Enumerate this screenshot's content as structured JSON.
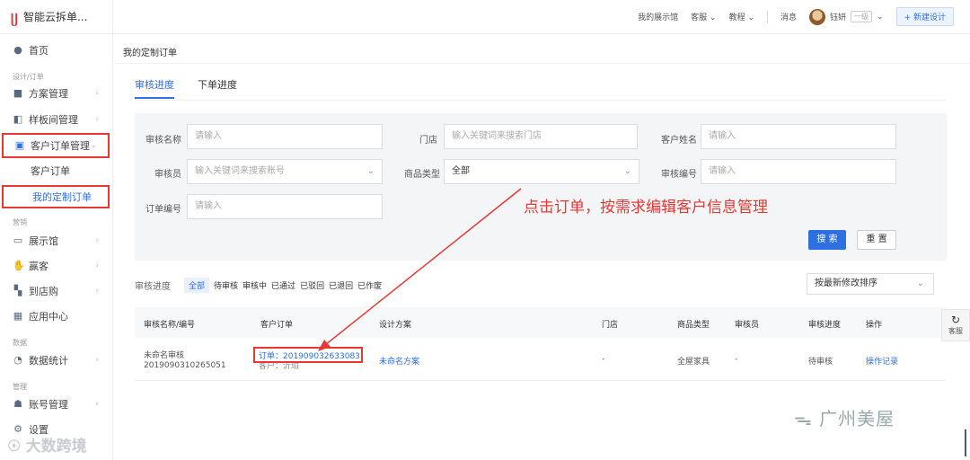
{
  "app": {
    "title": "智能云拆单..."
  },
  "sidebar": {
    "home": "首页",
    "group_design": "设计/订单",
    "plan_mgmt": "方案管理",
    "sample_mgmt": "样板间管理",
    "customer_order_mgmt": "客户订单管理",
    "customer_order": "客户订单",
    "my_custom_order": "我的定制订单",
    "group_marketing": "营销",
    "showroom": "展示馆",
    "earn": "赢客",
    "to_store": "到店购",
    "app_center": "应用中心",
    "group_data": "数据",
    "data_stats": "数据统计",
    "group_admin": "管理",
    "account_mgmt": "账号管理",
    "settings": "设置"
  },
  "topbar": {
    "my_showroom": "我的展示馆",
    "service": "客服",
    "tutorial": "教程",
    "messages": "消息",
    "username": "钰妍",
    "level": "一级",
    "new_design": "+ 新建设计"
  },
  "breadcrumb": "我的定制订单",
  "tabs": [
    {
      "label": "审核进度"
    },
    {
      "label": "下单进度"
    }
  ],
  "filter": {
    "review_name_label": "审核名称",
    "review_name_placeholder": "请输入",
    "store_label": "门店",
    "store_placeholder": "输入关键词来搜索门店",
    "customer_name_label": "客户姓名",
    "customer_name_placeholder": "请输入",
    "reviewer_label": "审核员",
    "reviewer_placeholder": "输入关键词来搜索账号",
    "product_type_label": "商品类型",
    "product_type_value": "全部",
    "review_no_label": "审核编号",
    "review_no_placeholder": "请输入",
    "order_no_label": "订单编号",
    "order_no_placeholder": "请输入",
    "search": "搜 索",
    "reset": "重 置"
  },
  "annotation": "点击订单，按需求编辑客户信息管理",
  "status": {
    "label": "审核进度",
    "items": [
      "全部",
      "待审核",
      "审核中",
      "已通过",
      "已驳回",
      "已退回",
      "已作废"
    ]
  },
  "sort": {
    "value": "按最新修改排序"
  },
  "table": {
    "headers": [
      "审核名称/编号",
      "客户订单",
      "设计方案",
      "门店",
      "商品类型",
      "审核员",
      "审核进度",
      "操作"
    ],
    "row": {
      "name": "未命名审核",
      "number": "2019090310265051",
      "order": "订单：2019090326330​83",
      "customer": "客户：沂珀",
      "design": "未命名方案",
      "store": "-",
      "product_type": "全屋家具",
      "reviewer": "-",
      "progress": "待审核",
      "action": "操作记录"
    }
  },
  "float": {
    "service": "客服"
  },
  "watermarks": {
    "right": "广州美屋",
    "left": "大数跨境"
  }
}
